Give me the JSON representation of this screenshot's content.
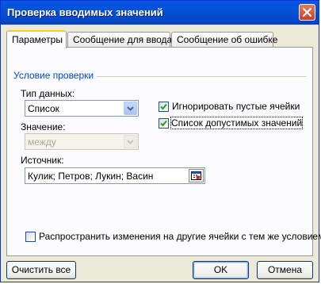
{
  "window": {
    "title": "Проверка вводимых значений"
  },
  "tabs": [
    {
      "label": "Параметры",
      "active": true
    },
    {
      "label": "Сообщение для ввода",
      "active": false
    },
    {
      "label": "Сообщение об ошибке",
      "active": false
    }
  ],
  "criteria": {
    "group_label": "Условие проверки",
    "data_type_label": "Тип данных:",
    "data_type_value": "Список",
    "value_label": "Значение:",
    "value_value": "между",
    "ignore_blank_label": "Игнорировать пустые ячейки",
    "ignore_blank_checked": true,
    "in_cell_dropdown_label": "Список допустимых значений",
    "in_cell_dropdown_checked": true,
    "source_label": "Источник:",
    "source_value": "Кулик; Петров; Лукин; Васин"
  },
  "apply_all": {
    "label": "Распространить изменения на другие ячейки с тем же условием",
    "checked": false
  },
  "buttons": {
    "clear_all": "Очистить все",
    "ok": "OK",
    "cancel": "Отмена"
  },
  "icons": {
    "close": "close-icon",
    "dropdown": "chevron-down-icon",
    "ref": "range-select-icon",
    "check": "check-icon"
  },
  "colors": {
    "titlebar": "#0454dc",
    "group_label": "#0046d5",
    "tab_highlight": "#ffc83c"
  }
}
